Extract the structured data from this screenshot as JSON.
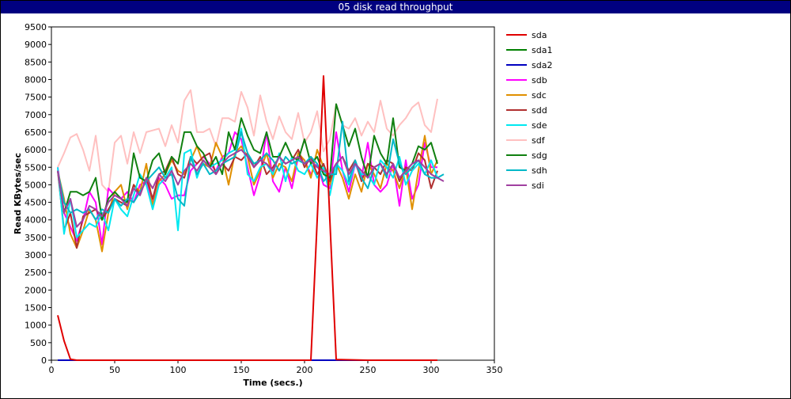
{
  "window": {
    "title": "05 disk read throughput"
  },
  "chart_data": {
    "type": "line",
    "title": "05 disk read throughput",
    "xlabel": "Time (secs.)",
    "ylabel": "Read KBytes/sec",
    "xlim": [
      0,
      350
    ],
    "ylim": [
      0,
      9500
    ],
    "xticks": [
      0,
      50,
      100,
      150,
      200,
      250,
      300,
      350
    ],
    "yticks": [
      0,
      500,
      1000,
      1500,
      2000,
      2500,
      3000,
      3500,
      4000,
      4500,
      5000,
      5500,
      6000,
      6500,
      7000,
      7500,
      8000,
      8500,
      9000,
      9500
    ],
    "grid": true,
    "legend_position": "right",
    "series": [
      {
        "name": "sda",
        "color": "#e00000",
        "x": [
          5,
          10,
          15,
          20,
          50,
          100,
          150,
          200,
          205,
          210,
          215,
          220,
          225,
          250,
          280,
          305
        ],
        "y": [
          1280,
          550,
          30,
          0,
          0,
          0,
          0,
          0,
          0,
          4000,
          8100,
          4000,
          20,
          0,
          0,
          0
        ]
      },
      {
        "name": "sda1",
        "color": "#008000",
        "x": [
          5,
          50,
          100,
          150,
          200,
          205,
          210,
          215,
          220,
          225,
          250,
          300,
          305
        ],
        "y": [
          0,
          0,
          0,
          0,
          0,
          0,
          0,
          0,
          0,
          0,
          0,
          0,
          0
        ]
      },
      {
        "name": "sda2",
        "color": "#0000c0",
        "x": [
          5,
          50,
          100,
          150,
          200,
          250,
          300,
          305
        ],
        "y": [
          0,
          0,
          0,
          0,
          0,
          0,
          0,
          0
        ]
      },
      {
        "name": "sdb",
        "color": "#ff00ff",
        "x": [
          5,
          10,
          15,
          20,
          25,
          30,
          35,
          40,
          45,
          50,
          55,
          60,
          65,
          70,
          75,
          80,
          85,
          90,
          95,
          100,
          105,
          110,
          115,
          120,
          125,
          130,
          135,
          140,
          145,
          150,
          155,
          160,
          165,
          170,
          175,
          180,
          185,
          190,
          195,
          200,
          205,
          210,
          215,
          220,
          225,
          230,
          235,
          240,
          245,
          250,
          255,
          260,
          265,
          270,
          275,
          280,
          285,
          290,
          295,
          300,
          305
        ],
        "y": [
          5500,
          4200,
          3800,
          3400,
          4000,
          4800,
          4500,
          3300,
          4900,
          4700,
          4600,
          4800,
          4500,
          5000,
          5100,
          4500,
          5200,
          5000,
          4600,
          4700,
          4700,
          5400,
          5600,
          5800,
          5600,
          5400,
          5800,
          5900,
          6500,
          6300,
          5500,
          4700,
          5300,
          6500,
          5100,
          4800,
          5500,
          4900,
          5800,
          5700,
          5300,
          5600,
          5000,
          4900,
          6500,
          5400,
          4800,
          5600,
          5200,
          6200,
          5000,
          4800,
          5000,
          5600,
          4400,
          5700,
          4600,
          5000,
          6200,
          5500,
          5500
        ]
      },
      {
        "name": "sdc",
        "color": "#e09000",
        "x": [
          5,
          10,
          15,
          20,
          25,
          30,
          35,
          40,
          45,
          50,
          55,
          60,
          65,
          70,
          75,
          80,
          85,
          90,
          95,
          100,
          105,
          110,
          115,
          120,
          125,
          130,
          135,
          140,
          145,
          150,
          155,
          160,
          165,
          170,
          175,
          180,
          185,
          190,
          195,
          200,
          205,
          210,
          215,
          220,
          225,
          230,
          235,
          240,
          245,
          250,
          255,
          260,
          265,
          270,
          275,
          280,
          285,
          290,
          295,
          300,
          305
        ],
        "y": [
          5400,
          4600,
          3600,
          3200,
          3700,
          4300,
          4000,
          3100,
          4200,
          4800,
          5000,
          4300,
          5000,
          4800,
          5600,
          4400,
          5100,
          5300,
          5700,
          5400,
          5300,
          5700,
          6100,
          5600,
          5500,
          6200,
          5800,
          5000,
          5900,
          6100,
          5800,
          5000,
          5400,
          5900,
          5200,
          5600,
          5500,
          5100,
          5900,
          5700,
          5200,
          6000,
          5500,
          5000,
          5600,
          5200,
          4600,
          5300,
          4800,
          5600,
          5300,
          4900,
          5600,
          5400,
          4900,
          5500,
          4300,
          5400,
          6400,
          5300,
          5700
        ]
      },
      {
        "name": "sdd",
        "color": "#b03030",
        "x": [
          5,
          10,
          15,
          20,
          25,
          30,
          35,
          40,
          45,
          50,
          55,
          60,
          65,
          70,
          75,
          80,
          85,
          90,
          95,
          100,
          105,
          110,
          115,
          120,
          125,
          130,
          135,
          140,
          145,
          150,
          155,
          160,
          165,
          170,
          175,
          180,
          185,
          190,
          195,
          200,
          205,
          210,
          215,
          220,
          225,
          230,
          235,
          240,
          245,
          250,
          255,
          260,
          265,
          270,
          275,
          280,
          285,
          290,
          295,
          300,
          305
        ],
        "y": [
          5400,
          3700,
          4200,
          3200,
          4100,
          4200,
          4300,
          4000,
          4300,
          4600,
          4500,
          4400,
          5000,
          4700,
          5200,
          4600,
          5300,
          5400,
          5800,
          5300,
          5200,
          5800,
          5600,
          5800,
          5900,
          5300,
          5600,
          5400,
          5800,
          5700,
          5900,
          5500,
          5800,
          5300,
          5500,
          5800,
          5600,
          5700,
          6000,
          5500,
          5800,
          5300,
          5600,
          5100,
          5600,
          5800,
          5400,
          5700,
          5100,
          5600,
          5500,
          5300,
          5700,
          5600,
          5100,
          5500,
          5400,
          5900,
          5700,
          4900,
          5400
        ]
      },
      {
        "name": "sde",
        "color": "#00e8f0",
        "x": [
          5,
          10,
          15,
          20,
          25,
          30,
          35,
          40,
          45,
          50,
          55,
          60,
          65,
          70,
          75,
          80,
          85,
          90,
          95,
          100,
          105,
          110,
          115,
          120,
          125,
          130,
          135,
          140,
          145,
          150,
          155,
          160,
          165,
          170,
          175,
          180,
          185,
          190,
          195,
          200,
          205,
          210,
          215,
          220,
          225,
          230,
          235,
          240,
          245,
          250,
          255,
          260,
          265,
          270,
          275,
          280,
          285,
          290,
          295,
          300,
          305
        ],
        "y": [
          5500,
          3600,
          4600,
          3500,
          3700,
          3900,
          3800,
          4200,
          3700,
          4600,
          4300,
          4100,
          4700,
          5300,
          5000,
          4300,
          5000,
          5200,
          5500,
          3700,
          5900,
          6000,
          5200,
          5700,
          5500,
          5600,
          5700,
          5900,
          6000,
          6600,
          5300,
          5100,
          5500,
          5600,
          5300,
          5900,
          5100,
          5800,
          5400,
          5300,
          5600,
          5200,
          5500,
          4700,
          5600,
          5400,
          5000,
          5600,
          5300,
          5300,
          5000,
          5700,
          5500,
          5200,
          5800,
          5000,
          5400,
          5600,
          5300,
          5700,
          5200
        ]
      },
      {
        "name": "sdf",
        "color": "#ffc0c0",
        "x": [
          5,
          10,
          15,
          20,
          25,
          30,
          35,
          40,
          45,
          50,
          55,
          60,
          65,
          70,
          75,
          80,
          85,
          90,
          95,
          100,
          105,
          110,
          115,
          120,
          125,
          130,
          135,
          140,
          145,
          150,
          155,
          160,
          165,
          170,
          175,
          180,
          185,
          190,
          195,
          200,
          205,
          210,
          215,
          220,
          225,
          230,
          235,
          240,
          245,
          250,
          255,
          260,
          265,
          270,
          275,
          280,
          285,
          290,
          295,
          300,
          305
        ],
        "y": [
          5500,
          5900,
          6350,
          6450,
          6000,
          5400,
          6400,
          5000,
          4800,
          6200,
          6400,
          5600,
          6500,
          5900,
          6500,
          6550,
          6600,
          6100,
          6700,
          6200,
          7400,
          7700,
          6500,
          6500,
          6600,
          6100,
          6900,
          6900,
          6800,
          7650,
          7200,
          6400,
          7550,
          6800,
          6300,
          6950,
          6500,
          6300,
          7050,
          6200,
          6500,
          7100,
          5950,
          6300,
          7300,
          6700,
          6600,
          6900,
          6400,
          6800,
          6500,
          7400,
          6600,
          6400,
          6700,
          6900,
          7200,
          7350,
          6700,
          6500,
          7450
        ]
      },
      {
        "name": "sdg",
        "color": "#108010",
        "x": [
          5,
          10,
          15,
          20,
          25,
          30,
          35,
          40,
          45,
          50,
          55,
          60,
          65,
          70,
          75,
          80,
          85,
          90,
          95,
          100,
          105,
          110,
          115,
          120,
          125,
          130,
          135,
          140,
          145,
          150,
          155,
          160,
          165,
          170,
          175,
          180,
          185,
          190,
          195,
          200,
          205,
          210,
          215,
          220,
          225,
          230,
          235,
          240,
          245,
          250,
          255,
          260,
          265,
          270,
          275,
          280,
          285,
          290,
          295,
          300,
          305
        ],
        "y": [
          5400,
          4200,
          4800,
          4800,
          4700,
          4800,
          5200,
          4000,
          4600,
          4800,
          4600,
          4500,
          5900,
          5200,
          5100,
          5700,
          5900,
          5300,
          5800,
          5600,
          6500,
          6500,
          6100,
          5900,
          5500,
          5800,
          5300,
          6500,
          6000,
          6900,
          6400,
          6000,
          5900,
          6500,
          5800,
          5800,
          6200,
          5800,
          5700,
          6300,
          5600,
          5800,
          5300,
          5200,
          7300,
          6700,
          6100,
          6600,
          5800,
          5200,
          6400,
          5900,
          5600,
          6900,
          5500,
          5400,
          5600,
          6100,
          6000,
          6200,
          5600
        ]
      },
      {
        "name": "sdh",
        "color": "#00b8c8",
        "x": [
          5,
          10,
          15,
          20,
          25,
          30,
          35,
          40,
          45,
          50,
          55,
          60,
          65,
          70,
          75,
          80,
          85,
          90,
          95,
          100,
          105,
          110,
          115,
          120,
          125,
          130,
          135,
          140,
          145,
          150,
          155,
          160,
          165,
          170,
          175,
          180,
          185,
          190,
          195,
          200,
          205,
          210,
          215,
          220,
          225,
          230,
          235,
          240,
          245,
          250,
          255,
          260,
          265,
          270,
          275,
          280,
          285,
          290,
          295,
          300,
          305,
          310
        ],
        "y": [
          5400,
          4500,
          4200,
          4300,
          4200,
          4300,
          4000,
          4300,
          4200,
          4600,
          4400,
          4600,
          4500,
          4800,
          5100,
          5300,
          5500,
          5200,
          5300,
          4600,
          4400,
          5800,
          5300,
          5600,
          5300,
          5400,
          5600,
          5700,
          5800,
          6500,
          5900,
          5600,
          5700,
          5900,
          5700,
          5400,
          5800,
          5600,
          5700,
          5600,
          5800,
          5600,
          5100,
          5300,
          5300,
          6800,
          5100,
          5700,
          5200,
          4900,
          5500,
          5600,
          5200,
          6300,
          5600,
          5300,
          5500,
          5700,
          5300,
          5200,
          5200,
          5300
        ]
      },
      {
        "name": "sdi",
        "color": "#a040a0",
        "x": [
          5,
          10,
          15,
          20,
          25,
          30,
          35,
          40,
          45,
          50,
          55,
          60,
          65,
          70,
          75,
          80,
          85,
          90,
          95,
          100,
          105,
          110,
          115,
          120,
          125,
          130,
          135,
          140,
          145,
          150,
          155,
          160,
          165,
          170,
          175,
          180,
          185,
          190,
          195,
          200,
          205,
          210,
          215,
          220,
          225,
          230,
          235,
          240,
          245,
          250,
          255,
          260,
          265,
          270,
          275,
          280,
          285,
          290,
          295,
          300,
          305,
          310
        ],
        "y": [
          5400,
          4200,
          4600,
          3800,
          4000,
          4400,
          4300,
          4100,
          4500,
          4700,
          4600,
          4400,
          4900,
          4700,
          5200,
          4900,
          5300,
          5100,
          5400,
          5000,
          5400,
          5600,
          5400,
          5700,
          5500,
          5300,
          5600,
          5800,
          5900,
          6000,
          5800,
          5500,
          5700,
          5600,
          5400,
          5800,
          5600,
          5700,
          5800,
          5600,
          5700,
          5500,
          5400,
          5300,
          5600,
          5800,
          5300,
          5600,
          5400,
          5200,
          5500,
          5600,
          5300,
          5600,
          5200,
          5400,
          5600,
          5700,
          5500,
          5300,
          5200,
          5100
        ]
      }
    ]
  }
}
